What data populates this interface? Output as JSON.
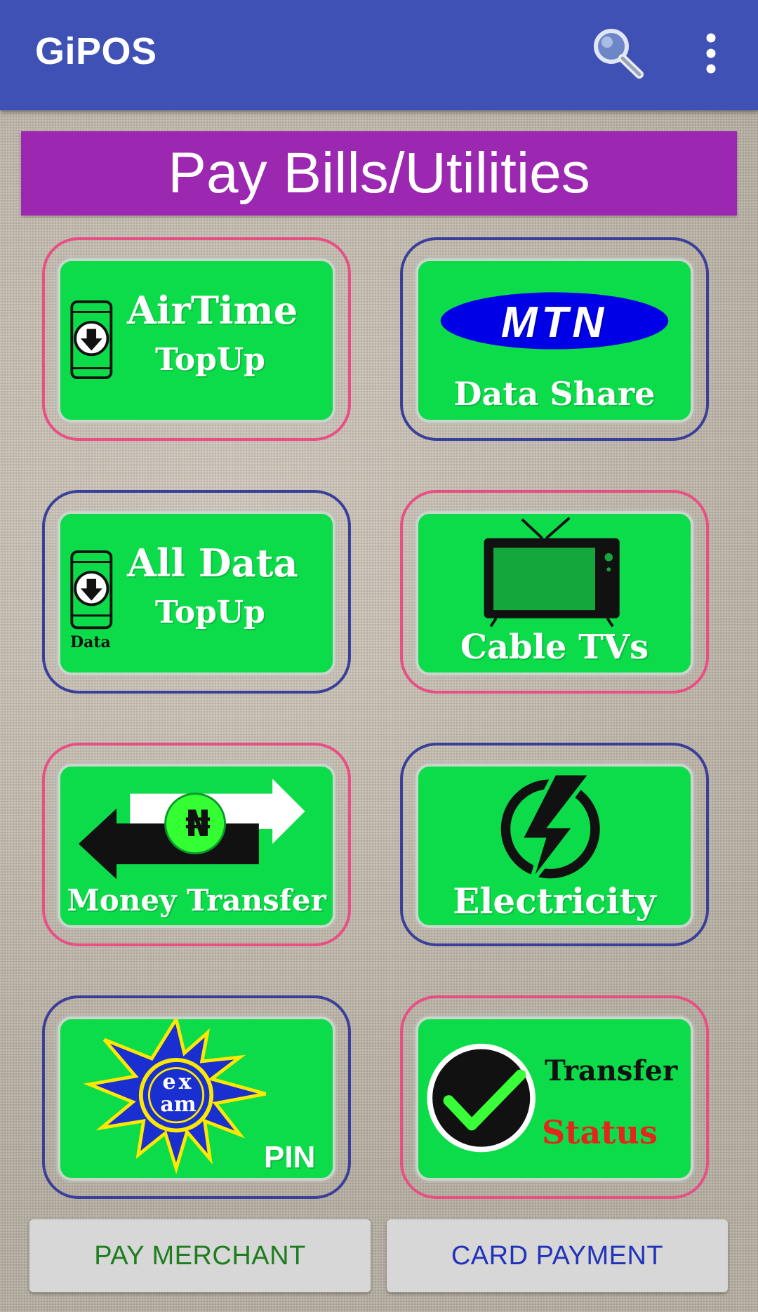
{
  "appbar": {
    "title": "GiPOS",
    "search_icon": "search-icon",
    "more_icon": "more-vert-icon",
    "color": "#3f51b5"
  },
  "banner": {
    "title": "Pay Bills/Utilities",
    "color": "#9c27b0"
  },
  "tiles": [
    {
      "line1": "AirTime",
      "line2": "TopUp",
      "icon": "phone-download-icon"
    },
    {
      "logo": "MTN",
      "line1": "Data Share",
      "icon": "mtn-logo"
    },
    {
      "line1": "All Data",
      "line2": "TopUp",
      "icon_caption": "Data",
      "icon": "phone-data-icon"
    },
    {
      "line1": "Cable TVs",
      "icon": "tv-icon"
    },
    {
      "symbol": "₦",
      "line1": "Money Transfer",
      "icon": "transfer-arrows-icon"
    },
    {
      "line1": "Electricity",
      "icon": "power-bolt-icon"
    },
    {
      "badge_line1": "ex",
      "badge_line2": "am",
      "line1": "PIN",
      "icon": "exam-badge-icon"
    },
    {
      "line1": "Transfer",
      "line2": "Status",
      "icon": "check-circle-icon"
    }
  ],
  "bottom": {
    "pay_merchant": "PAY MERCHANT",
    "card_payment": "CARD PAYMENT",
    "pay_merchant_color": "#1e7d1e",
    "card_payment_color": "#2233bb"
  },
  "colors": {
    "tile_green": "#0ddc4a",
    "frame_pink": "#e94e84",
    "frame_blue": "#3a3f9a"
  }
}
